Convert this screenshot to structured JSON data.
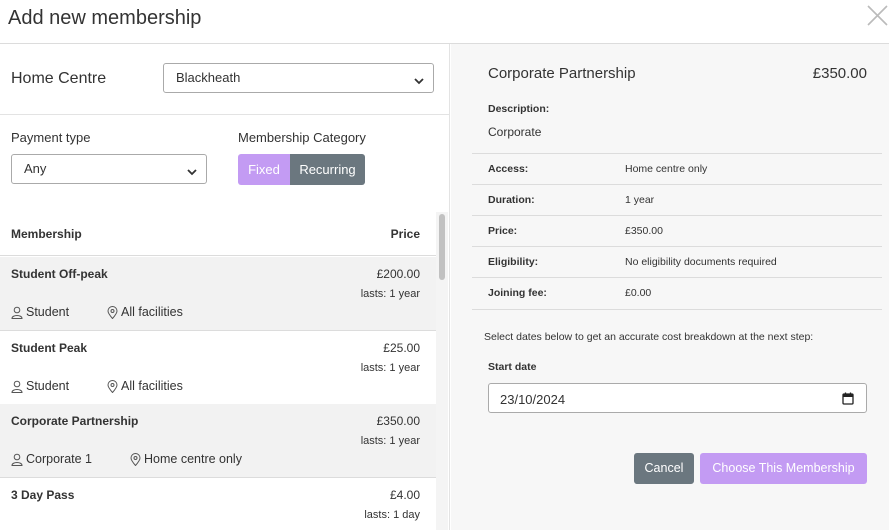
{
  "modal": {
    "title": "Add new membership"
  },
  "home_centre": {
    "label": "Home Centre",
    "value": "Blackheath"
  },
  "filters": {
    "payment_type_label": "Payment type",
    "payment_type_value": "Any",
    "category_label": "Membership Category",
    "category_options": [
      "Fixed",
      "Recurring"
    ],
    "category_selected": "Fixed"
  },
  "list": {
    "header_name": "Membership",
    "header_price": "Price",
    "rows": [
      {
        "name": "Student Off-peak",
        "price": "£200.00",
        "lasts": "lasts: 1 year",
        "audience": "Student",
        "access": "All facilities"
      },
      {
        "name": "Student Peak",
        "price": "£25.00",
        "lasts": "lasts: 1 year",
        "audience": "Student",
        "access": "All facilities"
      },
      {
        "name": "Corporate Partnership",
        "price": "£350.00",
        "lasts": "lasts: 1 year",
        "audience": "Corporate 1",
        "access": "Home centre only"
      },
      {
        "name": "3 Day Pass",
        "price": "£4.00",
        "lasts": "lasts: 1 day",
        "audience": "",
        "access": ""
      }
    ]
  },
  "detail": {
    "title": "Corporate Partnership",
    "price": "£350.00",
    "description_label": "Description:",
    "description": "Corporate",
    "fields": [
      {
        "key": "Access:",
        "value": "Home centre only"
      },
      {
        "key": "Duration:",
        "value": "1 year"
      },
      {
        "key": "Price:",
        "value": "£350.00"
      },
      {
        "key": "Eligibility:",
        "value": "No eligibility documents required"
      },
      {
        "key": "Joining fee:",
        "value": "£0.00"
      }
    ],
    "hint": "Select dates below to get an accurate cost breakdown at the next step:",
    "start_date_label": "Start date",
    "start_date_value": "23/10/2024",
    "cancel_label": "Cancel",
    "choose_label": "Choose This Membership"
  },
  "colors": {
    "accent": "#c39bf3",
    "secondary": "#6b777f"
  }
}
